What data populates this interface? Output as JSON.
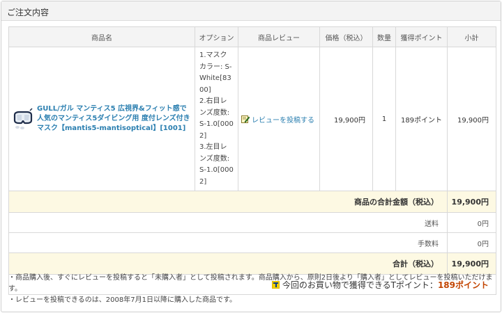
{
  "panel": {
    "title": "ご注文内容"
  },
  "table": {
    "headers": [
      "商品名",
      "オプション",
      "商品レビュー",
      "価格（税込）",
      "数量",
      "獲得ポイント",
      "小計"
    ],
    "item": {
      "name": "GULL/ガル マンティス5 広視界&フィット感で人気のマンティス5ダイビング用 度付レンズ付きマスク【mantis5-mantisoptical】[1001]",
      "options": [
        "1.マスクカラー: S-White[8300]",
        "2.右目レンズ度数: S-1.0[0002]",
        "3.左目レンズ度数: S-1.0[0002]"
      ],
      "review_link": "レビューを投稿する",
      "price": "19,900円",
      "quantity": "1",
      "points": "189ポイント",
      "subtotal": "19,900円"
    },
    "summary": {
      "goods_total_label": "商品の合計金額（税込）",
      "goods_total_value": "19,900円",
      "shipping_label": "送料",
      "shipping_value": "0円",
      "fee_label": "手数料",
      "fee_value": "0円",
      "total_label": "合計（税込）",
      "total_value": "19,900円",
      "tpoint_text": "今回のお買い物で獲得できるTポイント：",
      "tpoint_value": "189ポイント"
    }
  },
  "notes": [
    "・商品購入後、すぐにレビューを投稿すると「未購入者」として投稿されます。商品購入から、原則2日後より「購入者」としてレビューを投稿いただけます。",
    "・レビューを投稿できるのは、2008年7月1日以降に購入した商品です。"
  ],
  "colors": {
    "link": "#2b7fb0",
    "highlight_bg": "#fdf9e3",
    "point_value": "#c24400"
  }
}
